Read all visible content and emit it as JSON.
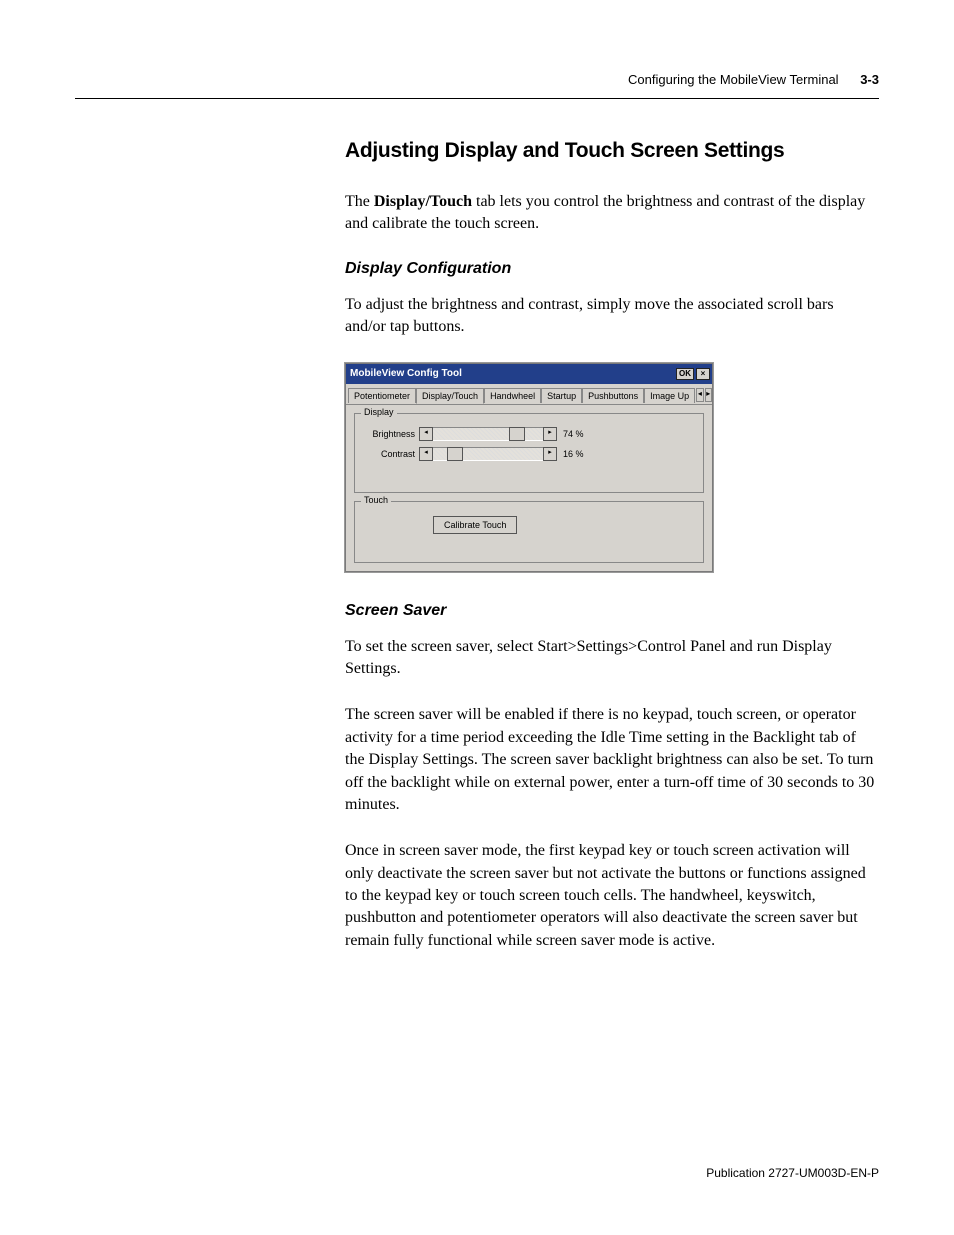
{
  "header": {
    "running_title": "Configuring the MobileView Terminal",
    "page_number": "3-3"
  },
  "section": {
    "heading": "Adjusting Display and Touch Screen Settings",
    "intro_pre": "The ",
    "intro_bold": "Display/Touch",
    "intro_post": " tab lets you control the brightness and contrast of the display and calibrate the touch screen."
  },
  "display_config": {
    "heading": "Display Configuration",
    "text": "To adjust the brightness and contrast, simply move the associated scroll bars and/or tap buttons."
  },
  "screenshot": {
    "title": "MobileView Config Tool",
    "ok": "OK",
    "close": "×",
    "tabs": [
      "Potentiometer",
      "Display/Touch",
      "Handwheel",
      "Startup",
      "Pushbuttons",
      "Image Up"
    ],
    "group_display": "Display",
    "brightness_label": "Brightness",
    "brightness_value": "74  %",
    "contrast_label": "Contrast",
    "contrast_value": "16  %",
    "group_touch": "Touch",
    "calibrate": "Calibrate Touch"
  },
  "screen_saver": {
    "heading": "Screen Saver",
    "p1": "To set the screen saver, select Start>Settings>Control Panel and run Display Settings.",
    "p2": "The screen saver will be enabled if there is no keypad, touch screen, or  operator activity for a time period exceeding the Idle Time setting in the  Backlight tab of the Display Settings. The screen saver backlight  brightness can also be set. To turn off the backlight while on external power,  enter a turn-off time of 30 seconds to 30 minutes.",
    "p3": "Once in screen saver mode, the first keypad key or touch screen activation will only deactivate the screen saver but not activate the buttons or functions assigned to the keypad key or touch screen touch cells. The handwheel, keyswitch, pushbutton and potentiometer operators will also deactivate the screen saver but remain fully functional while screen saver mode is active."
  },
  "footer": {
    "publication": "Publication 2727-UM003D-EN-P"
  }
}
